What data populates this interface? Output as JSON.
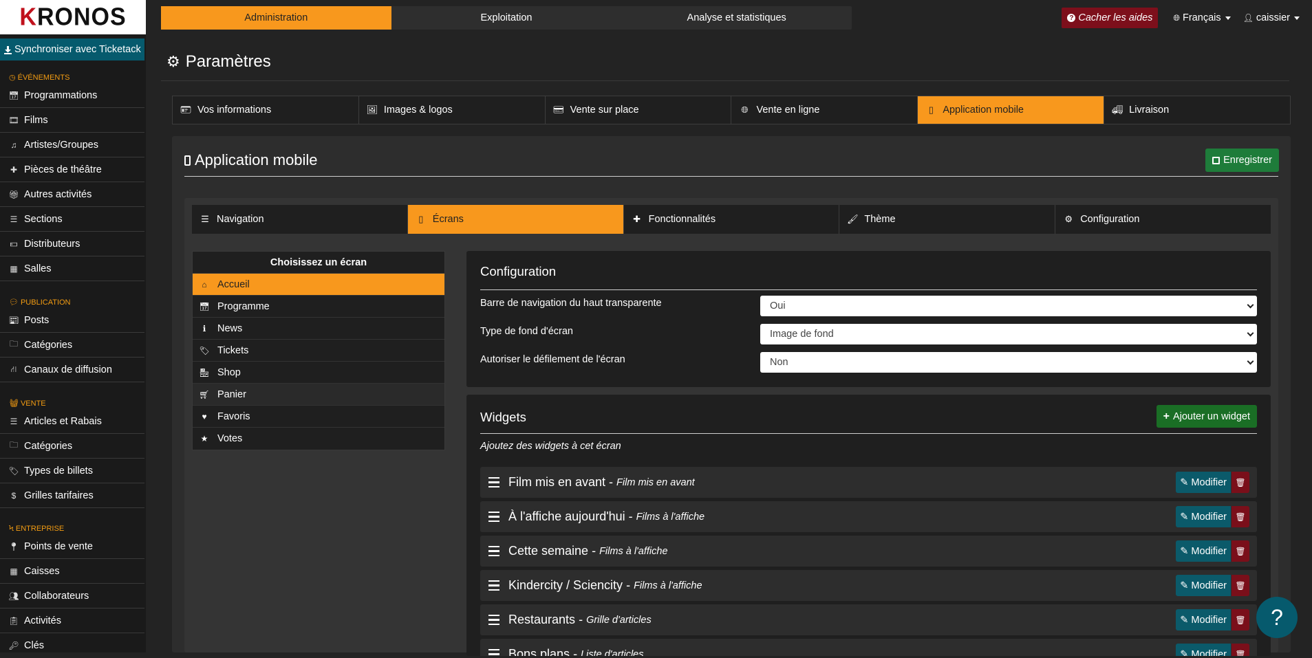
{
  "logo": {
    "first_letter": "K",
    "rest": "RONOS"
  },
  "sidebar": {
    "sync_label": "Synchroniser avec Ticketack",
    "sections": [
      {
        "title": "ÉVÉNEMENTS",
        "icon": "clock-icon",
        "items": [
          {
            "label": "Programmations",
            "icon": "calendar-icon"
          },
          {
            "label": "Films",
            "icon": "film-icon"
          },
          {
            "label": "Artistes/Groupes",
            "icon": "music-icon"
          },
          {
            "label": "Pièces de théâtre",
            "icon": "puzzle-icon"
          },
          {
            "label": "Autres activités",
            "icon": "gift-icon"
          },
          {
            "label": "Sections",
            "icon": "list-icon"
          },
          {
            "label": "Distributeurs",
            "icon": "money-icon"
          },
          {
            "label": "Salles",
            "icon": "grid-icon"
          }
        ]
      },
      {
        "title": "PUBLICATION",
        "icon": "comments-icon",
        "items": [
          {
            "label": "Posts",
            "icon": "newspaper-icon"
          },
          {
            "label": "Catégories",
            "icon": "folder-icon"
          },
          {
            "label": "Canaux de diffusion",
            "icon": "road-icon"
          }
        ]
      },
      {
        "title": "VENTE",
        "icon": "basket-icon",
        "items": [
          {
            "label": "Articles et Rabais",
            "icon": "list-icon"
          },
          {
            "label": "Catégories",
            "icon": "folder-icon"
          },
          {
            "label": "Types de billets",
            "icon": "tags-icon"
          },
          {
            "label": "Grilles tarifaires",
            "icon": "dollar-icon"
          }
        ]
      },
      {
        "title": "ENTREPRISE",
        "icon": "bolt-icon",
        "items": [
          {
            "label": "Points de vente",
            "icon": "map-marker-icon"
          },
          {
            "label": "Caisses",
            "icon": "grid-icon"
          },
          {
            "label": "Collaborateurs",
            "icon": "users-icon"
          },
          {
            "label": "Activités",
            "icon": "clipboard-icon"
          },
          {
            "label": "Clés",
            "icon": "key-icon"
          }
        ]
      }
    ]
  },
  "topnav": {
    "tabs": [
      "Administration",
      "Exploitation",
      "Analyse et statistiques"
    ],
    "active": 0
  },
  "topright": {
    "help_toggle": "Cacher les aides",
    "language": "Français",
    "user": "caissier"
  },
  "page": {
    "title": "Paramètres"
  },
  "settings_tabs": [
    {
      "label": "Vos informations",
      "icon": "id-card-icon"
    },
    {
      "label": "Images & logos",
      "icon": "image-icon"
    },
    {
      "label": "Vente sur place",
      "icon": "credit-card-icon"
    },
    {
      "label": "Vente en ligne",
      "icon": "globe-icon"
    },
    {
      "label": "Application mobile",
      "icon": "mobile-icon"
    },
    {
      "label": "Livraison",
      "icon": "truck-icon"
    }
  ],
  "panel": {
    "title": "Application mobile",
    "save_label": "Enregistrer"
  },
  "app_tabs": [
    {
      "label": "Navigation",
      "icon": "bars-icon"
    },
    {
      "label": "Écrans",
      "icon": "mobile-icon"
    },
    {
      "label": "Fonctionnalités",
      "icon": "puzzle-icon"
    },
    {
      "label": "Thème",
      "icon": "paintbrush-icon"
    },
    {
      "label": "Configuration",
      "icon": "gear-icon"
    }
  ],
  "screens": {
    "header": "Choisissez un écran",
    "items": [
      {
        "label": "Accueil",
        "icon": "home-icon"
      },
      {
        "label": "Programme",
        "icon": "calendar-icon"
      },
      {
        "label": "News",
        "icon": "info-icon"
      },
      {
        "label": "Tickets",
        "icon": "tag-icon"
      },
      {
        "label": "Shop",
        "icon": "shop-icon"
      },
      {
        "label": "Panier",
        "icon": "cart-icon"
      },
      {
        "label": "Favoris",
        "icon": "heart-icon"
      },
      {
        "label": "Votes",
        "icon": "star-icon"
      }
    ]
  },
  "config": {
    "title": "Configuration",
    "fields": [
      {
        "label": "Barre de navigation du haut transparente",
        "value": "Oui"
      },
      {
        "label": "Type de fond d'écran",
        "value": "Image de fond"
      },
      {
        "label": "Autoriser le défilement de l'écran",
        "value": "Non"
      }
    ]
  },
  "widgets": {
    "title": "Widgets",
    "add_label": "Ajouter un widget",
    "help": "Ajoutez des widgets à cet écran",
    "modify_label": "Modifier",
    "items": [
      {
        "title": "Film mis en avant",
        "sep": " - ",
        "type": "Film mis en avant"
      },
      {
        "title": "À l'affiche aujourd'hui",
        "sep": " - ",
        "type": "Films à l'affiche"
      },
      {
        "title": "Cette semaine",
        "sep": " - ",
        "type": "Films à l'affiche"
      },
      {
        "title": "Kindercity / Sciencity",
        "sep": " - ",
        "type": "Films à l'affiche"
      },
      {
        "title": "Restaurants",
        "sep": " - ",
        "type": "Grille d'articles"
      },
      {
        "title": "Bons plans",
        "sep": " - ",
        "type": "Liste d'articles"
      }
    ]
  },
  "help_fab": "?"
}
